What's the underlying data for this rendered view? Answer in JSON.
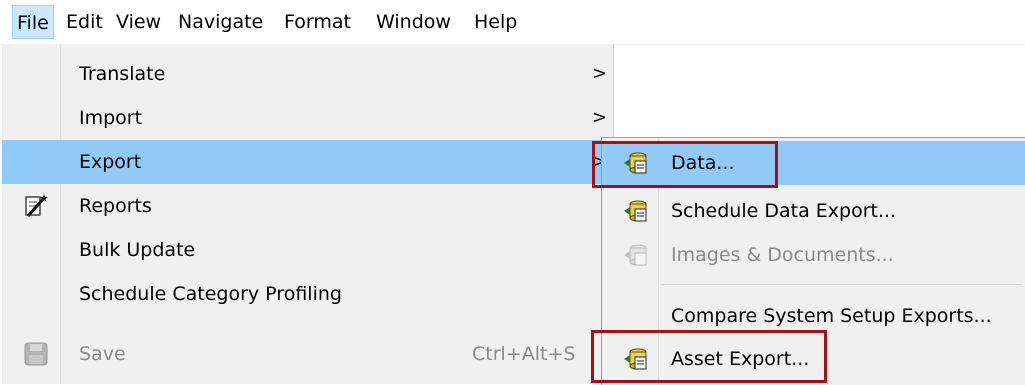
{
  "menubar": {
    "items": [
      "File",
      "Edit",
      "View",
      "Navigate",
      "Format",
      "Window",
      "Help"
    ]
  },
  "file_menu": {
    "items": [
      {
        "label": "Translate",
        "has_submenu": true
      },
      {
        "label": "Import",
        "has_submenu": true
      },
      {
        "label": "Export",
        "has_submenu": true,
        "highlighted": true
      },
      {
        "label": "Reports",
        "icon": "reports-wand-icon"
      },
      {
        "label": "Bulk Update",
        "has_submenu": true
      },
      {
        "label": "Schedule Category Profiling"
      },
      {
        "label": "Save",
        "shortcut": "Ctrl+Alt+S",
        "disabled": true,
        "icon": "save-disk-icon"
      }
    ],
    "arrow": ">"
  },
  "export_submenu": {
    "items": [
      {
        "label": "Data...",
        "icon": "db-export-icon",
        "highlighted": true
      },
      {
        "label": "Schedule Data Export...",
        "icon": "db-export-icon"
      },
      {
        "label": "Images & Documents...",
        "icon": "db-export-icon",
        "disabled": true
      },
      {
        "label": "Compare System Setup Exports..."
      },
      {
        "label": "Asset Export...",
        "icon": "db-export-icon"
      }
    ]
  },
  "colors": {
    "highlight": "#91c9f7",
    "menu_bg": "#f0f0f0",
    "annotation_red": "#a3101a"
  }
}
